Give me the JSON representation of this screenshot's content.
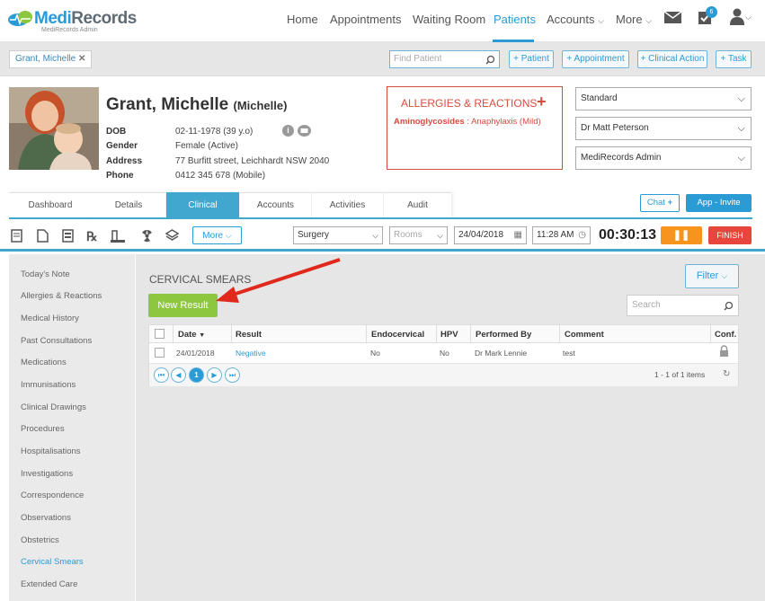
{
  "header": {
    "logo_name_a": "Medi",
    "logo_name_b": "Records",
    "logo_sub": "MediRecords Admin",
    "nav": [
      "Home",
      "Appointments",
      "Waiting Room",
      "Patients",
      "Accounts",
      "More"
    ],
    "tasks_badge": "6",
    "colors": {
      "accent": "#2b9bd6",
      "green": "#8dc63f",
      "red": "#e8453c",
      "orange": "#f7941d"
    }
  },
  "patient_bar": {
    "tab": "Grant, Michelle",
    "find_placeholder": "Find Patient",
    "buttons": [
      "+ Patient",
      "+ Appointment",
      "+ Clinical Action",
      "+ Task"
    ]
  },
  "patient": {
    "name": "Grant, Michelle",
    "preferred": "(Michelle)",
    "fields": [
      {
        "label": "DOB",
        "value": "02-11-1978 (39 y.o)"
      },
      {
        "label": "Gender",
        "value": "Female (Active)"
      },
      {
        "label": "Address",
        "value": "77 Burfitt street, Leichhardt NSW 2040"
      },
      {
        "label": "Phone",
        "value": "0412 345 678 (Mobile)"
      }
    ]
  },
  "allergies": {
    "title": "ALLERGIES & REACTIONS",
    "drug": "Aminoglycosides",
    "reaction": ": Anaphylaxis (Mild)"
  },
  "selects": [
    "Standard",
    "Dr Matt Peterson",
    "MediRecords Admin"
  ],
  "tabs": [
    "Dashboard",
    "Details",
    "Clinical",
    "Accounts",
    "Activities",
    "Audit"
  ],
  "tab_actions": {
    "chat": "Chat",
    "app_invite": "App - Invite"
  },
  "toolbar": {
    "more": "More",
    "location": "Surgery",
    "rooms_placeholder": "Rooms",
    "date": "24/04/2018",
    "time": "11:28 AM",
    "timer": "00:30:13",
    "finish": "FINISH"
  },
  "sidebar": [
    "Today's Note",
    "Allergies & Reactions",
    "Medical History",
    "Past Consultations",
    "Medications",
    "Immunisations",
    "Clinical Drawings",
    "Procedures",
    "Hospitalisations",
    "Investigations",
    "Correspondence",
    "Observations",
    "Obstetrics",
    "Cervical Smears",
    "Extended Care"
  ],
  "main": {
    "title": "CERVICAL SMEARS",
    "filter": "Filter",
    "new_result": "New Result",
    "search_placeholder": "Search"
  },
  "grid": {
    "columns": [
      "Date",
      "Result",
      "Endocervical",
      "HPV",
      "Performed By",
      "Comment",
      "Conf."
    ],
    "rows": [
      {
        "date": "24/01/2018",
        "result": "Negative",
        "endocervical": "No",
        "hpv": "No",
        "performed_by": "Dr Mark Lennie",
        "comment": "test"
      }
    ],
    "page": "1",
    "summary": "1 - 1 of 1 items"
  }
}
